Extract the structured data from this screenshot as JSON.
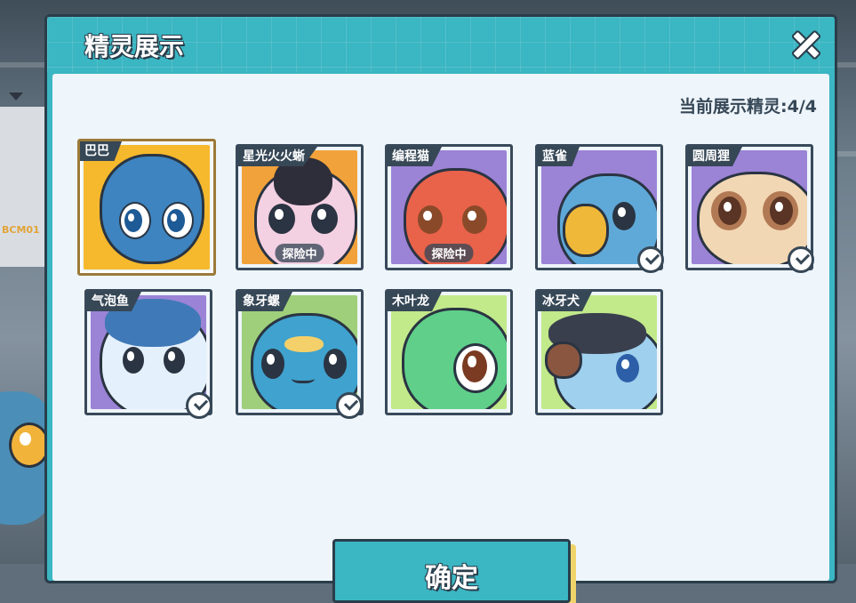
{
  "dialog": {
    "title": "精灵展示",
    "counter": "当前展示精灵:4/4",
    "confirm_label": "确定"
  },
  "background": {
    "shelf_tag": "BCM01"
  },
  "spirits": [
    {
      "name": "巴巴",
      "status": "",
      "selected": true,
      "displayed": false,
      "bg": "#f6b92d"
    },
    {
      "name": "星光火火蜥",
      "status": "探险中",
      "selected": false,
      "displayed": false,
      "bg": "#f2a23a"
    },
    {
      "name": "编程猫",
      "status": "探险中",
      "selected": false,
      "displayed": false,
      "bg": "#9b83d6"
    },
    {
      "name": "蓝雀",
      "status": "",
      "selected": false,
      "displayed": true,
      "bg": "#9b83d6"
    },
    {
      "name": "圆周狸",
      "status": "",
      "selected": false,
      "displayed": true,
      "bg": "#9b83d6"
    },
    {
      "name": "气泡鱼",
      "status": "",
      "selected": false,
      "displayed": true,
      "bg": "#9b83d6"
    },
    {
      "name": "象牙螺",
      "status": "",
      "selected": false,
      "displayed": true,
      "bg": "#9fcf7a"
    },
    {
      "name": "木叶龙",
      "status": "",
      "selected": false,
      "displayed": false,
      "bg": "#c2e98a"
    },
    {
      "name": "冰牙犬",
      "status": "",
      "selected": false,
      "displayed": false,
      "bg": "#c2e98a"
    }
  ]
}
